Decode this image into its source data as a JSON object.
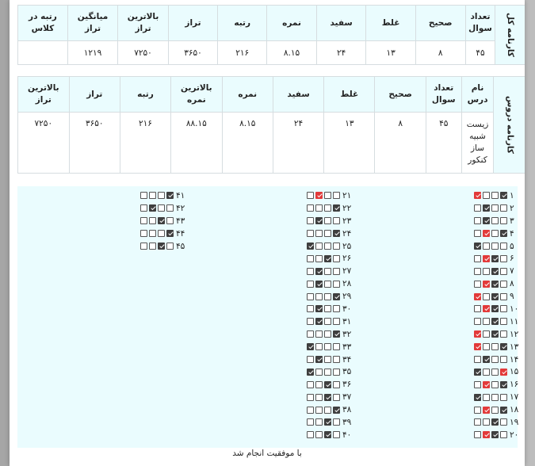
{
  "overall": {
    "side_label": "کارنامه کل",
    "headers": [
      "تعداد سوال",
      "صحیح",
      "غلط",
      "سفید",
      "نمره",
      "رتبه",
      "تراز",
      "بالاترین تراز",
      "میانگین تراز",
      "رتبه در کلاس"
    ],
    "values": [
      "۴۵",
      "۸",
      "۱۳",
      "۲۴",
      "۸.۱۵",
      "۲۱۶",
      "۳۶۵۰",
      "۷۲۵۰",
      "۱۲۱۹",
      ""
    ]
  },
  "lessons": {
    "side_label": "کارنامه دروس",
    "headers": [
      "نام درس",
      "تعداد سوال",
      "صحیح",
      "غلط",
      "سفید",
      "نمره",
      "بالاترین نمره",
      "رتبه",
      "تراز",
      "بالاترین تراز"
    ],
    "values": [
      "زیست شبیه ساز کنکور",
      "۴۵",
      "۸",
      "۱۳",
      "۲۴",
      "۸.۱۵",
      "۸۸.۱۵",
      "۲۱۶",
      "۳۶۵۰",
      "۷۲۵۰"
    ]
  },
  "answers": {
    "legend": {
      "dark": "#3f3f3f",
      "red": "#e23a3a"
    },
    "columns": [
      {
        "questions": [
          {
            "num": "۱",
            "marks": [
              "red",
              "",
              "",
              "dark"
            ]
          },
          {
            "num": "۲",
            "marks": [
              "",
              "dark",
              "",
              ""
            ]
          },
          {
            "num": "۳",
            "marks": [
              "",
              "dark",
              "",
              ""
            ]
          },
          {
            "num": "۴",
            "marks": [
              "",
              "red",
              "",
              "dark"
            ]
          },
          {
            "num": "۵",
            "marks": [
              "dark",
              "",
              "",
              ""
            ]
          },
          {
            "num": "۶",
            "marks": [
              "",
              "red",
              "dark",
              ""
            ]
          },
          {
            "num": "۷",
            "marks": [
              "",
              "",
              "dark",
              ""
            ]
          },
          {
            "num": "۸",
            "marks": [
              "",
              "red",
              "dark",
              ""
            ]
          },
          {
            "num": "۹",
            "marks": [
              "red",
              "",
              "dark",
              ""
            ]
          },
          {
            "num": "۱۰",
            "marks": [
              "",
              "red",
              "dark",
              ""
            ]
          },
          {
            "num": "۱۱",
            "marks": [
              "",
              "",
              "dark",
              ""
            ]
          },
          {
            "num": "۱۲",
            "marks": [
              "red",
              "",
              "dark",
              ""
            ]
          },
          {
            "num": "۱۳",
            "marks": [
              "red",
              "",
              "",
              "dark"
            ]
          },
          {
            "num": "۱۴",
            "marks": [
              "",
              "dark",
              "",
              ""
            ]
          },
          {
            "num": "۱۵",
            "marks": [
              "dark",
              "",
              "",
              "red"
            ]
          },
          {
            "num": "۱۶",
            "marks": [
              "",
              "red",
              "",
              "dark"
            ]
          },
          {
            "num": "۱۷",
            "marks": [
              "dark",
              "",
              "",
              ""
            ]
          },
          {
            "num": "۱۸",
            "marks": [
              "",
              "red",
              "",
              "dark"
            ]
          },
          {
            "num": "۱۹",
            "marks": [
              "",
              "",
              "dark",
              ""
            ]
          },
          {
            "num": "۲۰",
            "marks": [
              "",
              "red",
              "dark",
              ""
            ]
          }
        ]
      },
      {
        "questions": [
          {
            "num": "۲۱",
            "marks": [
              "",
              "red",
              "",
              ""
            ]
          },
          {
            "num": "۲۲",
            "marks": [
              "",
              "",
              "",
              "dark"
            ]
          },
          {
            "num": "۲۳",
            "marks": [
              "",
              "dark",
              "",
              ""
            ]
          },
          {
            "num": "۲۴",
            "marks": [
              "",
              "",
              "",
              "dark"
            ]
          },
          {
            "num": "۲۵",
            "marks": [
              "dark",
              "",
              "",
              ""
            ]
          },
          {
            "num": "۲۶",
            "marks": [
              "",
              "",
              "dark",
              ""
            ]
          },
          {
            "num": "۲۷",
            "marks": [
              "",
              "dark",
              "",
              ""
            ]
          },
          {
            "num": "۲۸",
            "marks": [
              "",
              "dark",
              "",
              ""
            ]
          },
          {
            "num": "۲۹",
            "marks": [
              "",
              "",
              "",
              "dark"
            ]
          },
          {
            "num": "۳۰",
            "marks": [
              "",
              "dark",
              "",
              ""
            ]
          },
          {
            "num": "۳۱",
            "marks": [
              "",
              "dark",
              "",
              ""
            ]
          },
          {
            "num": "۳۲",
            "marks": [
              "",
              "",
              "",
              "dark"
            ]
          },
          {
            "num": "۳۳",
            "marks": [
              "dark",
              "",
              "",
              ""
            ]
          },
          {
            "num": "۳۴",
            "marks": [
              "",
              "dark",
              "",
              ""
            ]
          },
          {
            "num": "۳۵",
            "marks": [
              "dark",
              "",
              "",
              ""
            ]
          },
          {
            "num": "۳۶",
            "marks": [
              "",
              "",
              "dark",
              ""
            ]
          },
          {
            "num": "۳۷",
            "marks": [
              "",
              "",
              "dark",
              ""
            ]
          },
          {
            "num": "۳۸",
            "marks": [
              "",
              "",
              "",
              "dark"
            ]
          },
          {
            "num": "۳۹",
            "marks": [
              "",
              "",
              "dark",
              ""
            ]
          },
          {
            "num": "۴۰",
            "marks": [
              "",
              "",
              "dark",
              ""
            ]
          }
        ]
      },
      {
        "questions": [
          {
            "num": "۴۱",
            "marks": [
              "",
              "",
              "",
              "dark"
            ]
          },
          {
            "num": "۴۲",
            "marks": [
              "",
              "dark",
              "",
              ""
            ]
          },
          {
            "num": "۴۳",
            "marks": [
              "",
              "",
              "dark",
              ""
            ]
          },
          {
            "num": "۴۴",
            "marks": [
              "",
              "",
              "",
              "dark"
            ]
          },
          {
            "num": "۴۵",
            "marks": [
              "",
              "",
              "dark",
              ""
            ]
          }
        ]
      }
    ]
  },
  "status_message": "با موفقیت انجام شد"
}
